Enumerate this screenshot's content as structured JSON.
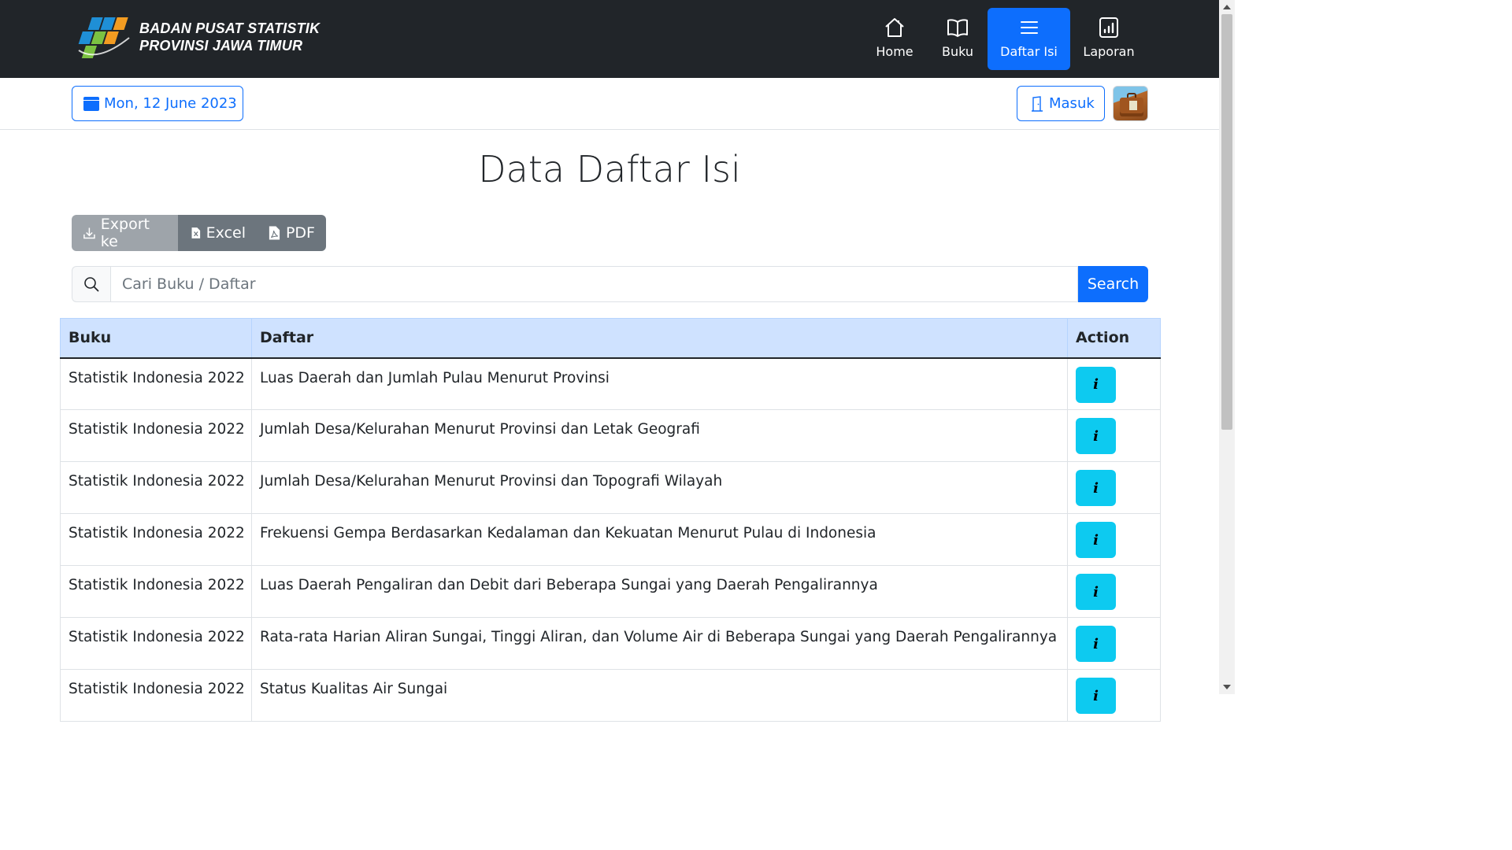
{
  "brand": {
    "line1": "BADAN PUSAT STATISTIK",
    "line2": "PROVINSI JAWA TIMUR"
  },
  "nav": [
    {
      "label": "Home",
      "icon": "house-icon",
      "active": false
    },
    {
      "label": "Buku",
      "icon": "book-icon",
      "active": false
    },
    {
      "label": "Daftar Isi",
      "icon": "list-icon",
      "active": true
    },
    {
      "label": "Laporan",
      "icon": "report-icon",
      "active": false
    }
  ],
  "subbar": {
    "date": "Mon, 12 June 2023",
    "login": "Masuk"
  },
  "page_title": "Data Daftar Isi",
  "export": {
    "lead": "Export ke",
    "excel": "Excel",
    "pdf": "PDF"
  },
  "search": {
    "placeholder": "Cari Buku / Daftar",
    "button": "Search"
  },
  "table": {
    "headers": {
      "buku": "Buku",
      "daftar": "Daftar",
      "action": "Action"
    },
    "rows": [
      {
        "buku": "Statistik Indonesia 2022",
        "daftar": "Luas Daerah dan Jumlah Pulau Menurut Provinsi",
        "action": "i"
      },
      {
        "buku": "Statistik Indonesia 2022",
        "daftar": "Jumlah Desa/Kelurahan Menurut Provinsi dan Letak Geografi",
        "action": "i"
      },
      {
        "buku": "Statistik Indonesia 2022",
        "daftar": "Jumlah Desa/Kelurahan Menurut Provinsi dan Topografi Wilayah",
        "action": "i"
      },
      {
        "buku": "Statistik Indonesia 2022",
        "daftar": "Frekuensi Gempa Berdasarkan Kedalaman dan Kekuatan Menurut Pulau di Indonesia",
        "action": "i"
      },
      {
        "buku": "Statistik Indonesia 2022",
        "daftar": "Luas Daerah Pengaliran dan Debit dari Beberapa Sungai yang Daerah Pengalirannya",
        "action": "i"
      },
      {
        "buku": "Statistik Indonesia 2022",
        "daftar": "Rata-rata Harian Aliran Sungai, Tinggi Aliran, dan Volume Air di Beberapa Sungai yang Daerah Pengalirannya",
        "action": "i"
      },
      {
        "buku": "Statistik Indonesia 2022",
        "daftar": "Status Kualitas Air Sungai",
        "action": "i"
      }
    ]
  },
  "colors": {
    "navbar": "#212529",
    "primary": "#0d6efd",
    "info": "#0dcaf0",
    "table_header": "#cfe2ff",
    "secondary": "#6c757d"
  }
}
